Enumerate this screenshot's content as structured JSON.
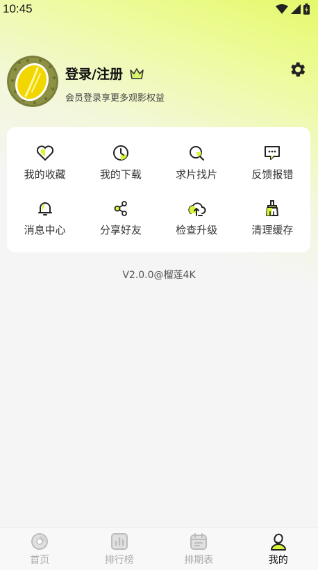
{
  "status_bar": {
    "time": "10:45"
  },
  "profile": {
    "username": "登录/注册",
    "subtitle": "会员登录享更多观影权益"
  },
  "menu": [
    {
      "label": "我的收藏",
      "icon": "heart-icon"
    },
    {
      "label": "我的下载",
      "icon": "download-clock-icon"
    },
    {
      "label": "求片找片",
      "icon": "search-icon"
    },
    {
      "label": "反馈报错",
      "icon": "message-icon"
    },
    {
      "label": "消息中心",
      "icon": "bell-icon"
    },
    {
      "label": "分享好友",
      "icon": "share-icon"
    },
    {
      "label": "检查升级",
      "icon": "upload-cloud-icon"
    },
    {
      "label": "清理缓存",
      "icon": "broom-icon"
    }
  ],
  "version": "V2.0.0@榴莲4K",
  "bottom_nav": [
    {
      "label": "首页",
      "icon": "home-icon",
      "active": false
    },
    {
      "label": "排行榜",
      "icon": "chart-icon",
      "active": false
    },
    {
      "label": "排期表",
      "icon": "calendar-icon",
      "active": false
    },
    {
      "label": "我的",
      "icon": "profile-icon",
      "active": true
    }
  ],
  "colors": {
    "accent": "#d8f53a",
    "bg": "#f5f5f5",
    "card": "#ffffff"
  }
}
